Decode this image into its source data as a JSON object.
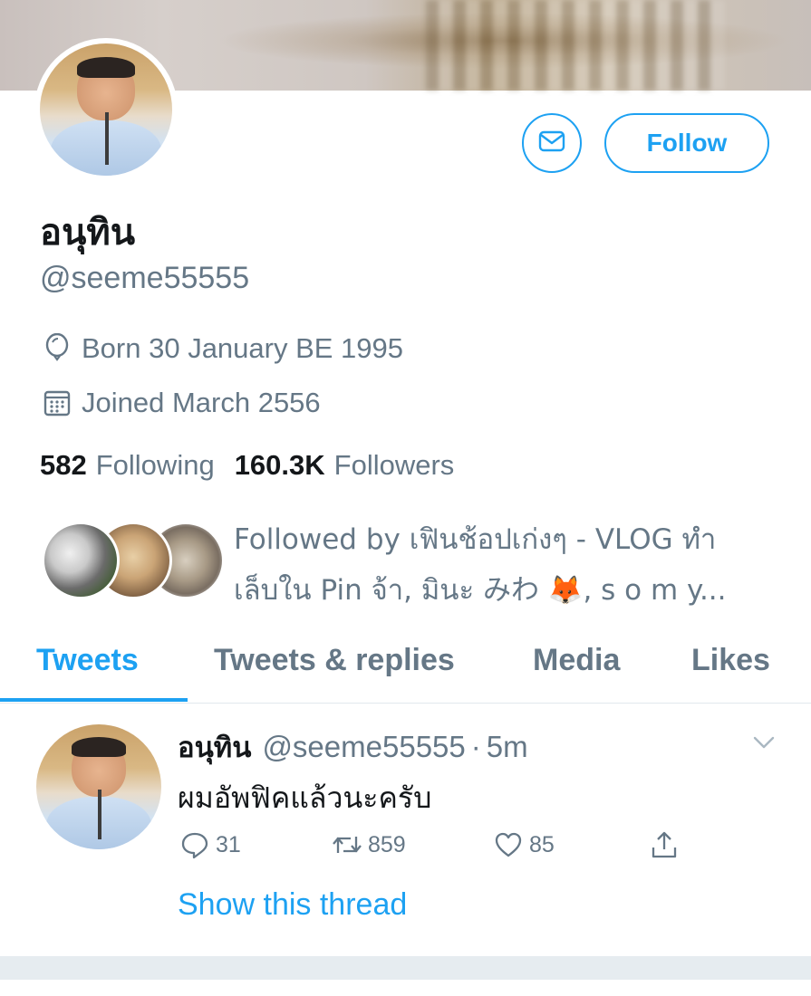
{
  "profile": {
    "display_name": "อนุทิน",
    "handle": "@seeme55555",
    "birthday": "Born 30 January BE 1995",
    "joined": "Joined March 2556",
    "following_count": "582",
    "following_label": "Following",
    "followers_count": "160.3K",
    "followers_label": "Followers",
    "followed_by_line1": "Followed by เฟินช้อปเก่งๆ - VLOG ทำ",
    "followed_by_line2": "เล็บใน Pin จ้า, มินะ みわ 🦊, s o m y..."
  },
  "actions": {
    "follow_label": "Follow",
    "message_icon": "mail-icon"
  },
  "tabs": [
    {
      "label": "Tweets",
      "active": true
    },
    {
      "label": "Tweets & replies",
      "active": false
    },
    {
      "label": "Media",
      "active": false
    },
    {
      "label": "Likes",
      "active": false
    }
  ],
  "tweet": {
    "name": "อนุทิน",
    "handle": "@seeme55555",
    "dot": "·",
    "time": "5m",
    "text": "ผมอัพฟิคแล้วนะครับ",
    "replies": "31",
    "retweets": "859",
    "likes": "85",
    "show_thread": "Show this thread"
  },
  "colors": {
    "accent": "#1da1f2",
    "secondary_text": "#657786",
    "primary_text": "#14171a"
  }
}
